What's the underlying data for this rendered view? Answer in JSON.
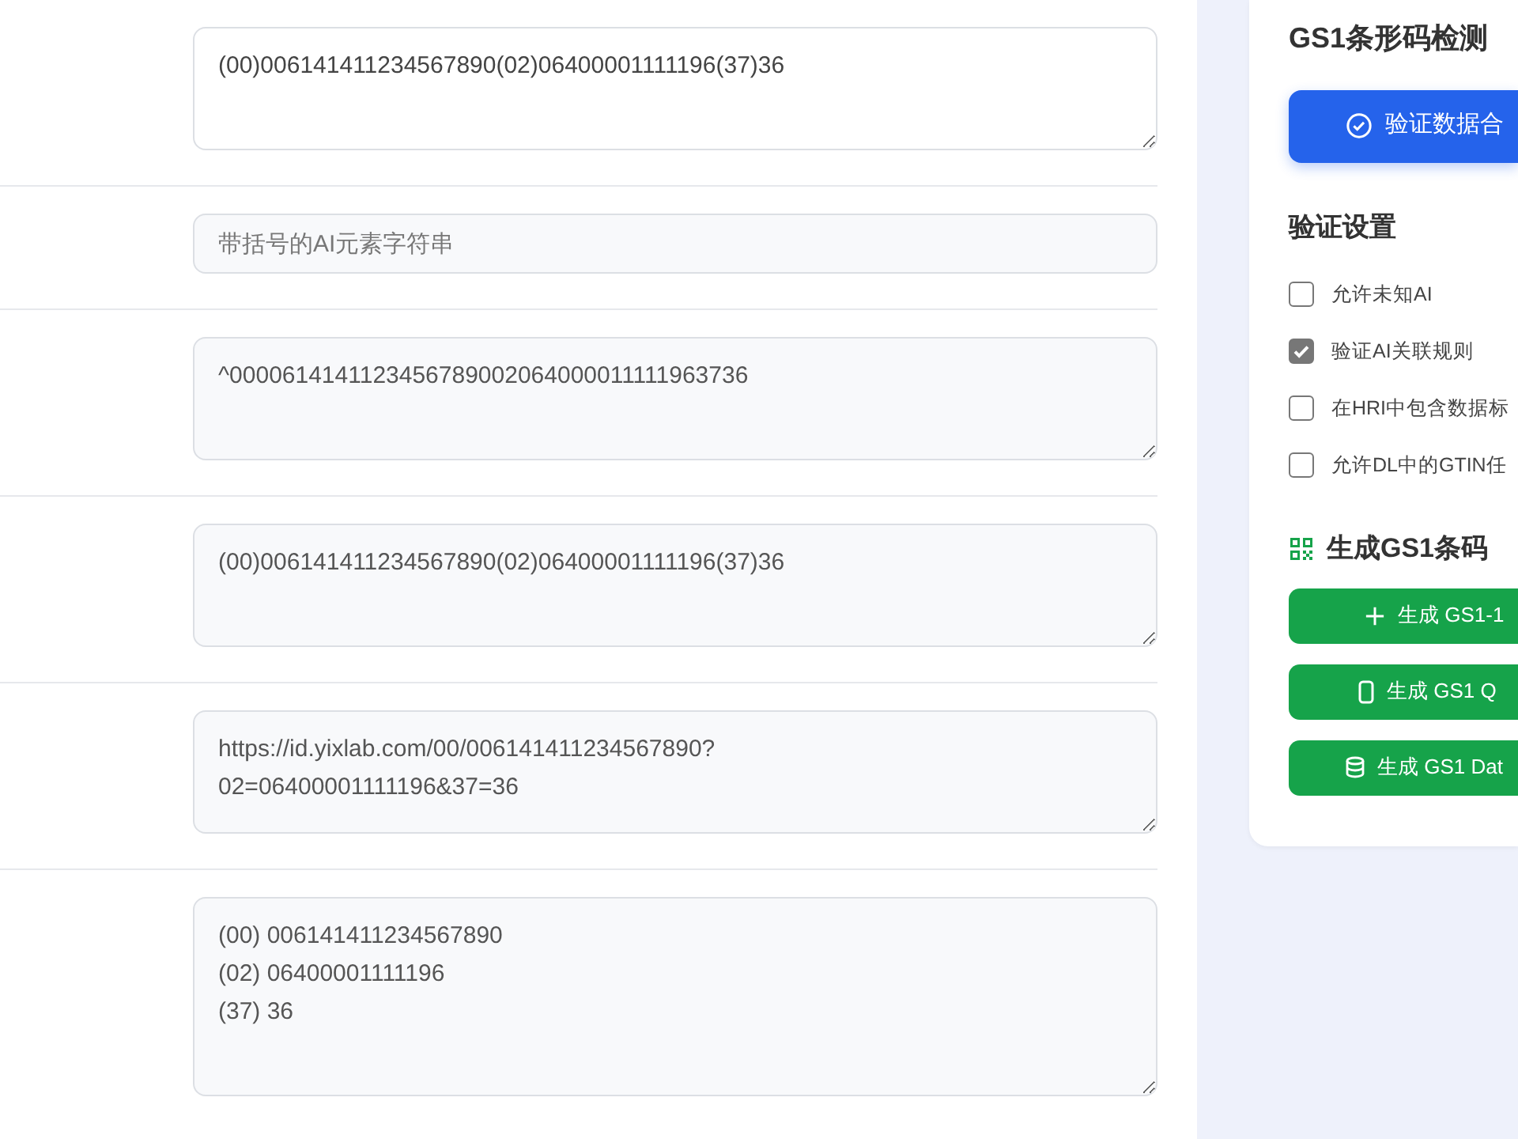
{
  "fields": [
    {
      "kind": "textarea",
      "value": "(00)006141411234567890(02)06400001111196(37)36",
      "readonly": false,
      "tall": false
    },
    {
      "kind": "input",
      "placeholder": "带括号的AI元素字符串"
    },
    {
      "kind": "textarea",
      "value": "^0000614141123456789002064000011111963736",
      "readonly": true,
      "tall": false
    },
    {
      "kind": "textarea",
      "value": "(00)006141411234567890(02)06400001111196(37)36",
      "readonly": true,
      "tall": false
    },
    {
      "kind": "textarea",
      "value": "https://id.yixlab.com/00/006141411234567890?\n02=06400001111196&37=36",
      "readonly": true,
      "tall": false
    },
    {
      "kind": "textarea",
      "value": "(00) 006141411234567890\n(02) 06400001111196\n(37) 36",
      "readonly": true,
      "tall": true
    }
  ],
  "panel": {
    "title": "GS1条形码检测",
    "verify_button": "验证数据合",
    "settings_title": "验证设置",
    "settings": [
      {
        "label": "允许未知AI",
        "checked": false
      },
      {
        "label": "验证AI关联规则",
        "checked": true
      },
      {
        "label": "在HRI中包含数据标",
        "checked": false
      },
      {
        "label": "允许DL中的GTIN任",
        "checked": false
      }
    ],
    "generate_title": "生成GS1条码",
    "generate_buttons": [
      "生成 GS1-1",
      "生成 GS1 Q",
      "生成 GS1 Dat"
    ]
  }
}
